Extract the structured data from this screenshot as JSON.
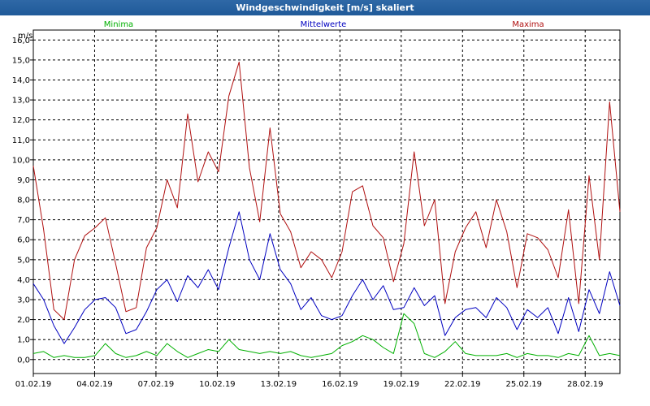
{
  "window": {
    "title": "Windgeschwindigkeit [m/s] skaliert"
  },
  "colors": {
    "minima": "#00b000",
    "mittelwerte": "#0000c0",
    "maxima": "#b01010",
    "grid": "#000000",
    "titlebar": "#1f5a99"
  },
  "chart_data": {
    "type": "line",
    "title": "Windgeschwindigkeit [m/s] skaliert",
    "ylabel": "m/s",
    "ylim": [
      -0.7,
      16.5
    ],
    "xlim_days": [
      1,
      29.7
    ],
    "y_ticks": [
      "0,0",
      "1,0",
      "2,0",
      "3,0",
      "4,0",
      "5,0",
      "6,0",
      "7,0",
      "8,0",
      "9,0",
      "10,0",
      "11,0",
      "12,0",
      "13,0",
      "14,0",
      "15,0",
      "16,0"
    ],
    "x_ticks": [
      "01.02.19",
      "04.02.19",
      "07.02.19",
      "10.02.19",
      "13.02.19",
      "16.02.19",
      "19.02.19",
      "22.02.19",
      "25.02.19",
      "28.02.19"
    ],
    "grid": true,
    "legend_position": "top",
    "x": [
      "01.02.19",
      "01.02.19 12h",
      "02.02.19",
      "02.02.19 12h",
      "03.02.19",
      "03.02.19 12h",
      "04.02.19",
      "04.02.19 12h",
      "05.02.19",
      "05.02.19 12h",
      "06.02.19",
      "06.02.19 12h",
      "07.02.19",
      "07.02.19 12h",
      "08.02.19",
      "08.02.19 12h",
      "09.02.19",
      "09.02.19 12h",
      "10.02.19",
      "10.02.19 12h",
      "11.02.19",
      "11.02.19 12h",
      "12.02.19",
      "12.02.19 12h",
      "13.02.19",
      "13.02.19 12h",
      "14.02.19",
      "14.02.19 12h",
      "15.02.19",
      "15.02.19 12h",
      "16.02.19",
      "16.02.19 12h",
      "17.02.19",
      "17.02.19 12h",
      "18.02.19",
      "18.02.19 12h",
      "19.02.19",
      "19.02.19 12h",
      "20.02.19",
      "20.02.19 12h",
      "21.02.19",
      "21.02.19 12h",
      "22.02.19",
      "22.02.19 12h",
      "23.02.19",
      "23.02.19 12h",
      "24.02.19",
      "24.02.19 12h",
      "25.02.19",
      "25.02.19 12h",
      "26.02.19",
      "26.02.19 12h",
      "27.02.19",
      "27.02.19 12h",
      "28.02.19",
      "28.02.19 12h",
      "01.03.19",
      "01.03.19 12h"
    ],
    "series": [
      {
        "name": "Minima",
        "values": [
          0.3,
          0.4,
          0.1,
          0.2,
          0.1,
          0.1,
          0.2,
          0.8,
          0.3,
          0.1,
          0.2,
          0.4,
          0.2,
          0.8,
          0.4,
          0.1,
          0.3,
          0.5,
          0.4,
          1.0,
          0.5,
          0.4,
          0.3,
          0.4,
          0.3,
          0.4,
          0.2,
          0.1,
          0.2,
          0.3,
          0.7,
          0.9,
          1.2,
          1.0,
          0.6,
          0.3,
          2.3,
          1.8,
          0.3,
          0.1,
          0.4,
          0.9,
          0.3,
          0.2,
          0.2,
          0.2,
          0.3,
          0.1,
          0.3,
          0.2,
          0.2,
          0.1,
          0.3,
          0.2,
          1.2,
          0.2,
          0.3,
          0.2
        ]
      },
      {
        "name": "Mittelwerte",
        "values": [
          3.8,
          3.0,
          1.7,
          0.8,
          1.6,
          2.5,
          3.0,
          3.1,
          2.6,
          1.3,
          1.5,
          2.4,
          3.5,
          4.0,
          2.9,
          4.2,
          3.6,
          4.5,
          3.5,
          5.6,
          7.4,
          5.0,
          4.0,
          6.3,
          4.5,
          3.8,
          2.5,
          3.1,
          2.2,
          2.0,
          2.2,
          3.2,
          4.0,
          3.0,
          3.7,
          2.5,
          2.6,
          3.6,
          2.7,
          3.2,
          1.2,
          2.1,
          2.5,
          2.6,
          2.1,
          3.1,
          2.6,
          1.5,
          2.5,
          2.1,
          2.6,
          1.3,
          3.1,
          1.4,
          3.5,
          2.3,
          4.4,
          2.7
        ]
      },
      {
        "name": "Maxima",
        "values": [
          9.7,
          6.5,
          2.5,
          2.0,
          5.0,
          6.2,
          6.6,
          7.1,
          4.8,
          2.4,
          2.6,
          5.6,
          6.6,
          9.0,
          7.6,
          12.3,
          8.9,
          10.4,
          9.4,
          13.2,
          14.9,
          9.6,
          6.9,
          11.6,
          7.3,
          6.4,
          4.6,
          5.4,
          5.0,
          4.1,
          5.4,
          8.4,
          8.7,
          6.7,
          6.1,
          3.9,
          5.8,
          10.4,
          6.7,
          8.0,
          2.8,
          5.4,
          6.6,
          7.4,
          5.6,
          8.0,
          6.4,
          3.6,
          6.3,
          6.1,
          5.5,
          4.1,
          7.5,
          2.8,
          9.2,
          5.0,
          12.9,
          7.4
        ]
      }
    ]
  }
}
